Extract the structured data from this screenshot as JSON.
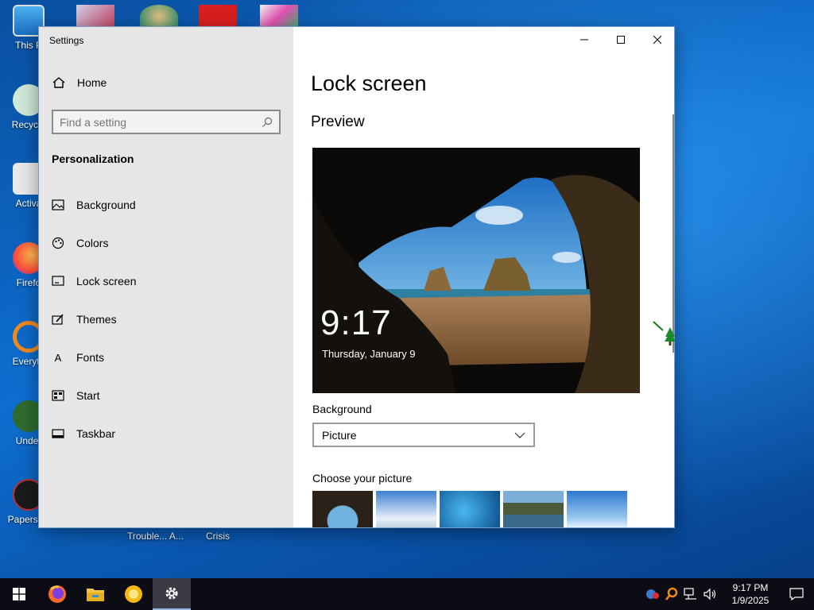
{
  "desktop": {
    "icons": [
      {
        "label": "This P",
        "icon": "this-pc-icon"
      },
      {
        "label": "Recycle",
        "icon": "recycle-bin-icon"
      },
      {
        "label": "Activa",
        "icon": "activation-icon"
      },
      {
        "label": "Firefo",
        "icon": "firefox-icon"
      },
      {
        "label": "Everyth",
        "icon": "everything-search-icon"
      },
      {
        "label": "Under",
        "icon": "undertale-icon"
      },
      {
        "label": "Papers, P",
        "icon": "papers-please-icon"
      }
    ],
    "bottom_labels": [
      "Trouble... A...",
      "Crisis"
    ]
  },
  "window": {
    "title": "Settings",
    "controls": {
      "minimize": "minimize-icon",
      "maximize": "maximize-icon",
      "close": "close-icon"
    }
  },
  "sidebar": {
    "home_label": "Home",
    "search_placeholder": "Find a setting",
    "section": "Personalization",
    "items": [
      {
        "label": "Background",
        "icon": "picture-icon"
      },
      {
        "label": "Colors",
        "icon": "palette-icon"
      },
      {
        "label": "Lock screen",
        "icon": "lock-screen-icon"
      },
      {
        "label": "Themes",
        "icon": "brush-icon"
      },
      {
        "label": "Fonts",
        "icon": "font-icon"
      },
      {
        "label": "Start",
        "icon": "start-menu-icon"
      },
      {
        "label": "Taskbar",
        "icon": "taskbar-icon"
      }
    ],
    "selected_item": "Lock screen"
  },
  "content": {
    "title": "Lock screen",
    "preview_heading": "Preview",
    "preview_time": "9:17",
    "preview_date": "Thursday, January 9",
    "background_label": "Background",
    "background_value": "Picture",
    "choose_label": "Choose your picture",
    "thumbnails": [
      "cave-beach",
      "clouds-sky",
      "ice-water",
      "mountain-lake",
      "sky-horizon"
    ]
  },
  "taskbar": {
    "apps": [
      "windows-start-icon",
      "firefox-icon",
      "file-explorer-icon",
      "yellow-circle-app-icon",
      "settings-gear-icon"
    ],
    "active_app": "settings-gear-icon",
    "clock_time": "9:17 PM",
    "clock_date": "1/9/2025"
  },
  "colors": {
    "sidebar_bg": "#e6e6e6",
    "taskbar_bg": "#0c0c14",
    "desktop_blue": "#0b63b6"
  }
}
